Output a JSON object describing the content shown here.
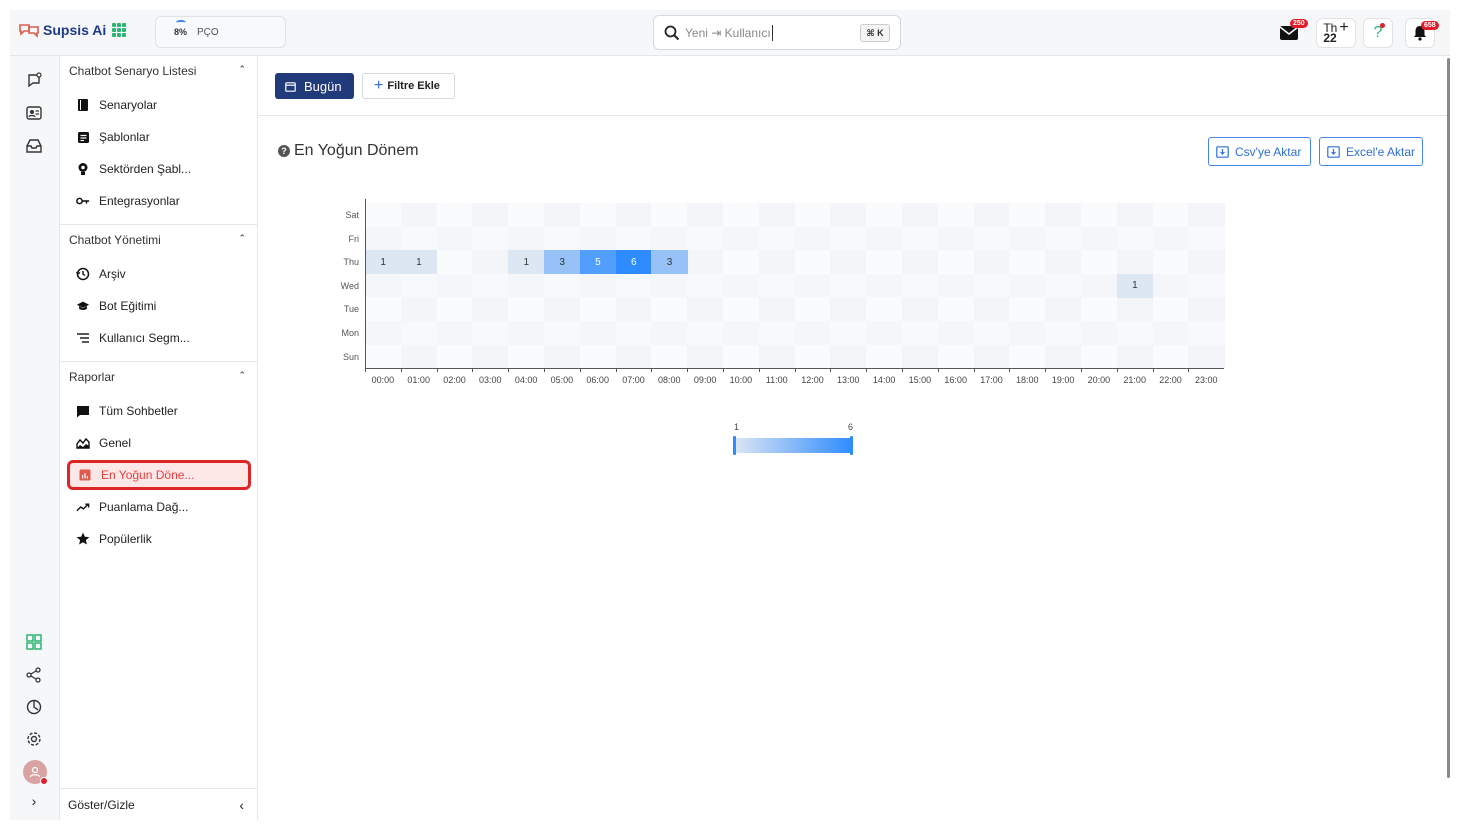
{
  "brand": {
    "name": "Supsis Ai"
  },
  "topbar": {
    "workspace_pct": "8%",
    "workspace_name": "PÇO",
    "search_placeholder": "Yeni ⇥ Kullanıcı",
    "search_shortcut": "⌘ K",
    "mail_badge": "250",
    "date_weekday": "Th",
    "date_day": "22",
    "help_label": "?",
    "notif_badge": "658"
  },
  "sidebar": {
    "sections": [
      {
        "title": "Chatbot Senaryo Listesi",
        "items": [
          {
            "label": "Senaryolar",
            "icon": "book-icon"
          },
          {
            "label": "Şablonlar",
            "icon": "template-icon"
          },
          {
            "label": "Sektörden Şabl...",
            "icon": "bulb-icon"
          },
          {
            "label": "Entegrasyonlar",
            "icon": "key-icon"
          }
        ]
      },
      {
        "title": "Chatbot Yönetimi",
        "items": [
          {
            "label": "Arşiv",
            "icon": "history-icon"
          },
          {
            "label": "Bot Eğitimi",
            "icon": "graduation-icon"
          },
          {
            "label": "Kullanıcı Segm...",
            "icon": "segment-icon"
          }
        ]
      },
      {
        "title": "Raporlar",
        "items": [
          {
            "label": "Tüm Sohbetler",
            "icon": "chat-icon"
          },
          {
            "label": "Genel",
            "icon": "area-chart-icon"
          },
          {
            "label": "En Yoğun Döne...",
            "icon": "bar-chart-icon",
            "active": true
          },
          {
            "label": "Puanlama Dağ...",
            "icon": "trend-icon"
          },
          {
            "label": "Popülerlik",
            "icon": "star-icon"
          }
        ]
      }
    ],
    "footer": "Göster/Gizle"
  },
  "toolbar": {
    "today_label": "Bugün",
    "filter_label": "Filtre Ekle"
  },
  "card": {
    "title": "En Yoğun Dönem",
    "csv_label": "Csv'ye Aktar",
    "excel_label": "Excel'e Aktar"
  },
  "colors": {
    "accent": "#213a7a",
    "active_red": "#dc2626",
    "heat_high": "#2f8cff",
    "heat_low": "#dde6f3"
  },
  "chart_data": {
    "type": "heatmap",
    "x": [
      "00:00",
      "01:00",
      "02:00",
      "03:00",
      "04:00",
      "05:00",
      "06:00",
      "07:00",
      "08:00",
      "09:00",
      "10:00",
      "11:00",
      "12:00",
      "13:00",
      "14:00",
      "15:00",
      "16:00",
      "17:00",
      "18:00",
      "19:00",
      "20:00",
      "21:00",
      "22:00",
      "23:00"
    ],
    "y": [
      "Sat",
      "Fri",
      "Thu",
      "Wed",
      "Tue",
      "Mon",
      "Sun"
    ],
    "cells": [
      {
        "day": "Thu",
        "hour": "00:00",
        "value": 1
      },
      {
        "day": "Thu",
        "hour": "01:00",
        "value": 1
      },
      {
        "day": "Thu",
        "hour": "04:00",
        "value": 1
      },
      {
        "day": "Thu",
        "hour": "05:00",
        "value": 3
      },
      {
        "day": "Thu",
        "hour": "06:00",
        "value": 5
      },
      {
        "day": "Thu",
        "hour": "07:00",
        "value": 6
      },
      {
        "day": "Thu",
        "hour": "08:00",
        "value": 3
      },
      {
        "day": "Wed",
        "hour": "21:00",
        "value": 1
      }
    ],
    "legend_min": "1",
    "legend_max": "6",
    "value_range": [
      1,
      6
    ]
  }
}
